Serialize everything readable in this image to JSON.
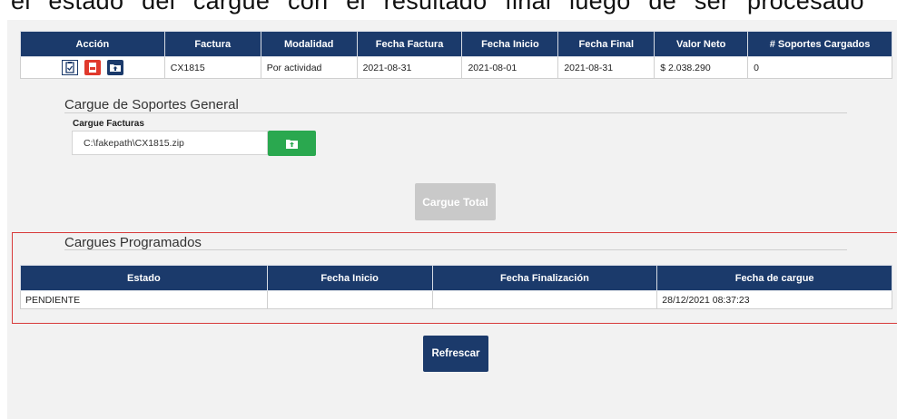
{
  "caption_top": "el estado del cargue con el resultado final luego de ser procesado",
  "invoice_table": {
    "headers": [
      "Acción",
      "Factura",
      "Modalidad",
      "Fecha Factura",
      "Fecha Inicio",
      "Fecha Final",
      "Valor Neto",
      "# Soportes Cargados"
    ],
    "row": {
      "actions": [
        "clipboard-check-icon",
        "pdf-file-icon",
        "upload-folder-icon"
      ],
      "factura": "CX1815",
      "modalidad": "Por actividad",
      "fecha_factura": "2021-08-31",
      "fecha_inicio": "2021-08-01",
      "fecha_final": "2021-08-31",
      "valor_neto": "$ 2.038.290",
      "soportes": "0"
    }
  },
  "upload_section": {
    "title": "Cargue de Soportes General",
    "field_label": "Cargue Facturas",
    "file_value": "C:\\fakepath\\CX1815.zip",
    "upload_icon": "upload-folder-icon",
    "total_button": "Cargue Total"
  },
  "scheduled_section": {
    "title": "Cargues Programados",
    "headers": [
      "Estado",
      "Fecha Inicio",
      "Fecha Finalización",
      "Fecha de cargue"
    ],
    "rows": [
      {
        "estado": "PENDIENTE",
        "fecha_inicio": "",
        "fecha_finalizacion": "",
        "fecha_cargue": "28/12/2021 08:37:23"
      }
    ]
  },
  "refresh_button": "Refrescar",
  "colors": {
    "header_navy": "#1b3a6b",
    "upload_green": "#2aa84f",
    "highlight_red": "#d83a3a",
    "disabled_gray": "#c9c9c9"
  }
}
